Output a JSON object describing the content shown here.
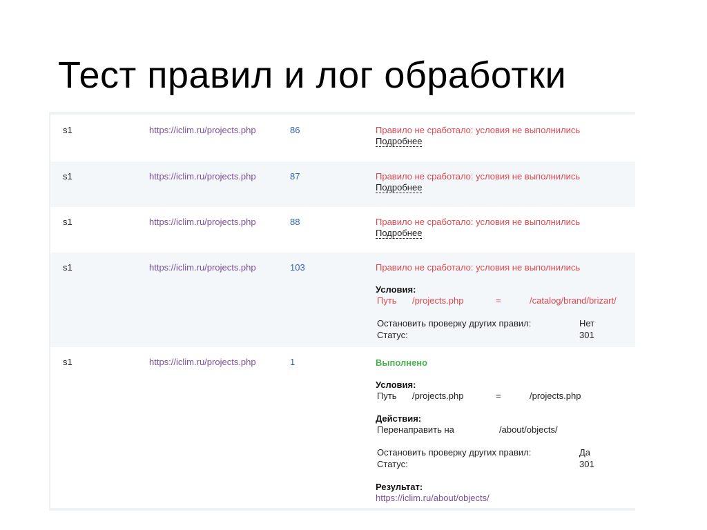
{
  "page_title": "Тест правил и лог обработки",
  "more_label": "Подробнее",
  "rows": [
    {
      "site": "s1",
      "url": "https://iclim.ru/projects.php",
      "id": "86",
      "status": "Правило не сработало: условия не выполнились"
    },
    {
      "site": "s1",
      "url": "https://iclim.ru/projects.php",
      "id": "87",
      "status": "Правило не сработало: условия не выполнились"
    },
    {
      "site": "s1",
      "url": "https://iclim.ru/projects.php",
      "id": "88",
      "status": "Правило не сработало: условия не выполнились"
    },
    {
      "site": "s1",
      "url": "https://iclim.ru/projects.php",
      "id": "103",
      "status": "Правило не сработало: условия не выполнились",
      "conditions_title": "Условия:",
      "condition": {
        "field": "Путь",
        "value": "/projects.php",
        "op": "=",
        "target": "/catalog/brand/brizart/"
      },
      "stop_label": "Остановить проверку других правил:",
      "stop_value": "Нет",
      "status_label": "Статус:",
      "status_value": "301"
    },
    {
      "site": "s1",
      "url": "https://iclim.ru/projects.php",
      "id": "1",
      "status": "Выполнено",
      "conditions_title": "Условия:",
      "condition": {
        "field": "Путь",
        "value": "/projects.php",
        "op": "=",
        "target": "/projects.php"
      },
      "actions_title": "Действия:",
      "action": {
        "label": "Перенаправить на",
        "target": "/about/objects/"
      },
      "stop_label": "Остановить проверку других правил:",
      "stop_value": "Да",
      "status_label": "Статус:",
      "status_value": "301",
      "result_title": "Результат:",
      "result_url": "https://iclim.ru/about/objects/"
    }
  ]
}
